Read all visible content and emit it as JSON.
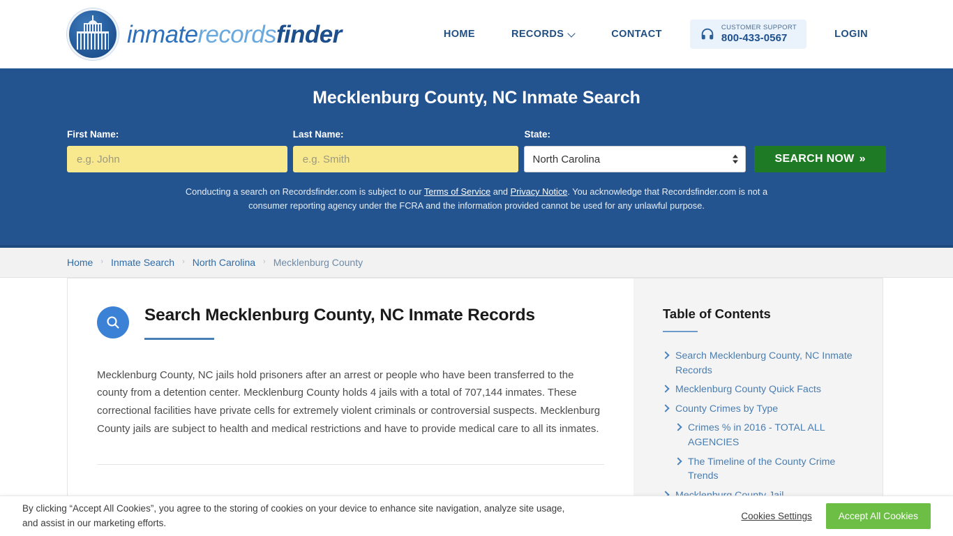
{
  "header": {
    "brand": {
      "part1": "inmate",
      "part2": "records",
      "part3": "finder"
    },
    "nav": [
      {
        "label": "HOME",
        "caret": false
      },
      {
        "label": "RECORDS",
        "caret": true
      },
      {
        "label": "CONTACT",
        "caret": false
      }
    ],
    "support": {
      "label": "CUSTOMER SUPPORT",
      "phone": "800-433-0567",
      "icon": "headset-icon"
    },
    "login_label": "LOGIN"
  },
  "hero": {
    "title": "Mecklenburg County, NC Inmate Search",
    "first_name_label": "First Name:",
    "first_name_placeholder": "e.g. John",
    "first_name_value": "",
    "last_name_label": "Last Name:",
    "last_name_placeholder": "e.g. Smith",
    "last_name_value": "",
    "state_label": "State:",
    "state_value": "North Carolina",
    "state_options": [
      "North Carolina"
    ],
    "search_button": "SEARCH NOW",
    "search_button_chevrons": "»",
    "disclaimer_pre": "Conducting a search on Recordsfinder.com is subject to our ",
    "disclaimer_link1": "Terms of Service",
    "disclaimer_mid": " and ",
    "disclaimer_link2": "Privacy Notice",
    "disclaimer_post": ". You acknowledge that Recordsfinder.com is not a consumer reporting agency under the FCRA and the information provided cannot be used for any unlawful purpose."
  },
  "breadcrumb": {
    "items": [
      {
        "label": "Home",
        "current": false
      },
      {
        "label": "Inmate Search",
        "current": false
      },
      {
        "label": "North Carolina",
        "current": false
      },
      {
        "label": "Mecklenburg County",
        "current": true
      }
    ],
    "separator": "›"
  },
  "main": {
    "icon": "search-icon",
    "title": "Search Mecklenburg County, NC Inmate Records",
    "paragraph": "Mecklenburg County, NC jails hold prisoners after an arrest or people who have been transferred to the county from a detention center. Mecklenburg County holds 4 jails with a total of 707,144 inmates. These correctional facilities have private cells for extremely violent criminals or controversial suspects. Mecklenburg County jails are subject to health and medical restrictions and have to provide medical care to all its inmates."
  },
  "toc": {
    "title": "Table of Contents",
    "items": [
      {
        "label": "Search Mecklenburg County, NC Inmate Records",
        "sub": false
      },
      {
        "label": "Mecklenburg County Quick Facts",
        "sub": false
      },
      {
        "label": "County Crimes by Type",
        "sub": false
      },
      {
        "label": "Crimes % in 2016 - TOTAL ALL AGENCIES",
        "sub": true
      },
      {
        "label": "The Timeline of the County Crime Trends",
        "sub": true
      },
      {
        "label": "Mecklenburg County Jail",
        "sub": false
      }
    ]
  },
  "cookies": {
    "text": "By clicking “Accept All Cookies”, you agree to the storing of cookies on your device to enhance site navigation, analyze site usage, and assist in our marketing efforts.",
    "settings_label": "Cookies Settings",
    "accept_label": "Accept All Cookies",
    "accept_color": "#6cbf44"
  },
  "colors": {
    "hero_blue": "#23548f",
    "brand_dark": "#1d4f8c",
    "accent_blue": "#3b82d6",
    "search_green": "#1e7a24",
    "input_yellow": "#f8e98e"
  }
}
